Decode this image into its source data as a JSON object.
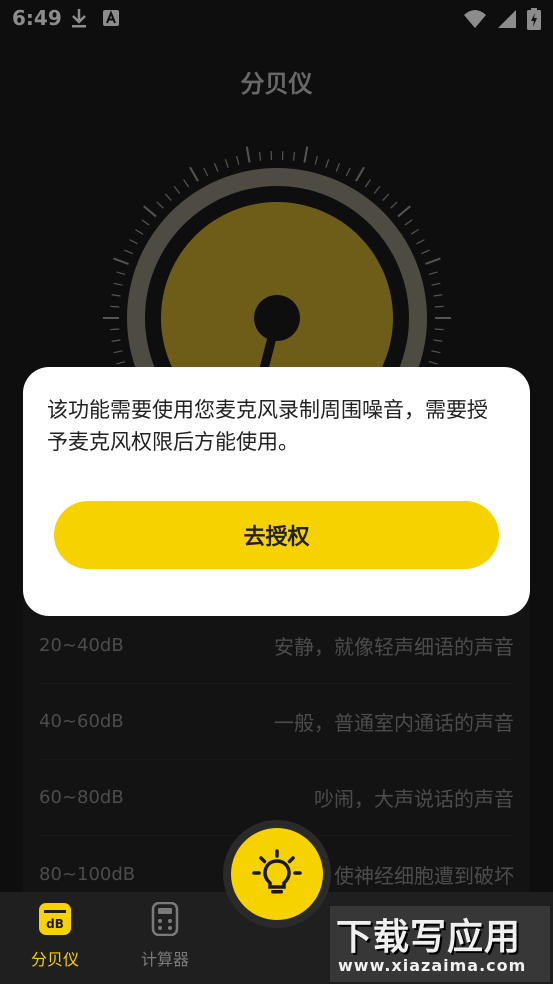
{
  "status_bar": {
    "time": "6:49",
    "left_icons": [
      "download-icon",
      "a-box-icon"
    ],
    "right_icons": [
      "wifi-icon",
      "signal-icon",
      "battery-charging-icon"
    ]
  },
  "page": {
    "title": "分贝仪"
  },
  "dial": {
    "accent": "#c9a92f"
  },
  "ranges": [
    {
      "db": "20~40dB",
      "desc": "安静，就像轻声细语的声音"
    },
    {
      "db": "40~60dB",
      "desc": "一般，普通室内通话的声音"
    },
    {
      "db": "60~80dB",
      "desc": "吵闹，大声说话的声音"
    },
    {
      "db": "80~100dB",
      "desc": "使神经细胞遭到破坏"
    }
  ],
  "dialog": {
    "message": "该功能需要使用您麦克风录制周围噪音，需要授予麦克风权限后方能使用。",
    "button_label": "去授权"
  },
  "tabs": [
    {
      "label": "分贝仪",
      "icon": "db-icon",
      "active": true
    },
    {
      "label": "计算器",
      "icon": "calculator-icon",
      "active": false
    }
  ],
  "fab": {
    "icon": "lightbulb-icon"
  },
  "watermark": {
    "main": "下载写应用",
    "url": "www.xiazaima.com"
  },
  "colors": {
    "accent": "#f6d200",
    "background": "#1a1a1a",
    "text_muted": "#8a8a8a"
  }
}
